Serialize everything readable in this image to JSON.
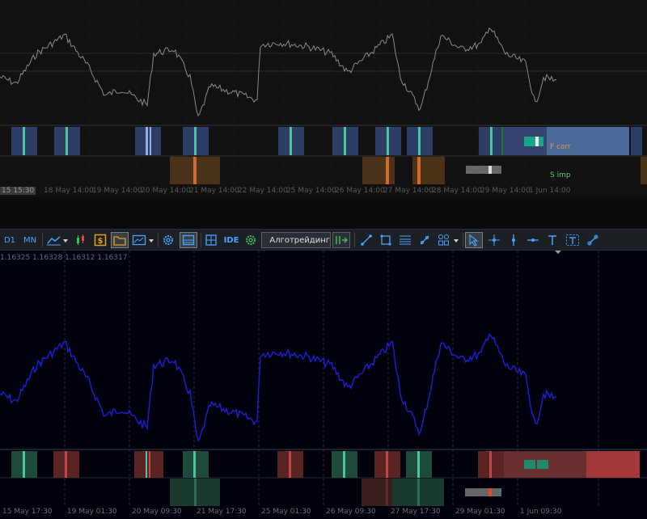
{
  "top_chart": {
    "indicator_labels": {
      "f_corr": "F corr",
      "s_imp": "S imp"
    },
    "time_axis": {
      "first_label": "15 15:30",
      "labels": [
        "18 May 14:00",
        "19 May 14:00",
        "20 May 14:00",
        "21 May 14:00",
        "22 May 14:00",
        "25 May 14:00",
        "26 May 14:00",
        "27 May 14:00",
        "28 May 14:00",
        "29 May 14:00",
        "1 Jun 14:00"
      ]
    },
    "colors": {
      "price_line": "#8a8a8a",
      "blue_band": "#2c3d66",
      "orange_band": "#4a3218",
      "f_corr_text": "#e0954a",
      "s_imp_text": "#56d36b"
    }
  },
  "toolbar": {
    "timeframes": [
      "D1",
      "MN"
    ],
    "ide_label": "IDE",
    "algo_label": "Алготрейдинг",
    "icons": [
      "chart-type-icon",
      "dropdown-icon",
      "indicators-icon",
      "dollar-icon",
      "folder-icon",
      "chart-template-icon",
      "dropdown-icon",
      "settings-icon",
      "layout-icon",
      "grid-icon",
      "ide-icon",
      "gear-icon",
      "play-icon",
      "algo-trading-icon",
      "trendline-icon",
      "rectangle-icon",
      "channel-icon",
      "fibo-icon",
      "shapes-icon",
      "dropdown-icon",
      "cursor-icon",
      "crosshair-icon",
      "vertical-line-icon",
      "horizontal-line-icon",
      "text-icon",
      "text-label-icon",
      "arrow-tool-icon"
    ]
  },
  "bottom_chart": {
    "ohlc": "1.16325 1.16328 1.16312 1.16317",
    "time_axis": {
      "labels": [
        "15 May 17:30",
        "19 May 01:30",
        "20 May 09:30",
        "21 May 17:30",
        "25 May 01:30",
        "26 May 09:30",
        "27 May 17:30",
        "29 May 01:30",
        "1 Jun 09:30"
      ]
    },
    "colors": {
      "price_line": "#1a1fd8",
      "green_band": "#1e4a3a",
      "red_band": "#5a2424",
      "background": "#00000c"
    }
  }
}
